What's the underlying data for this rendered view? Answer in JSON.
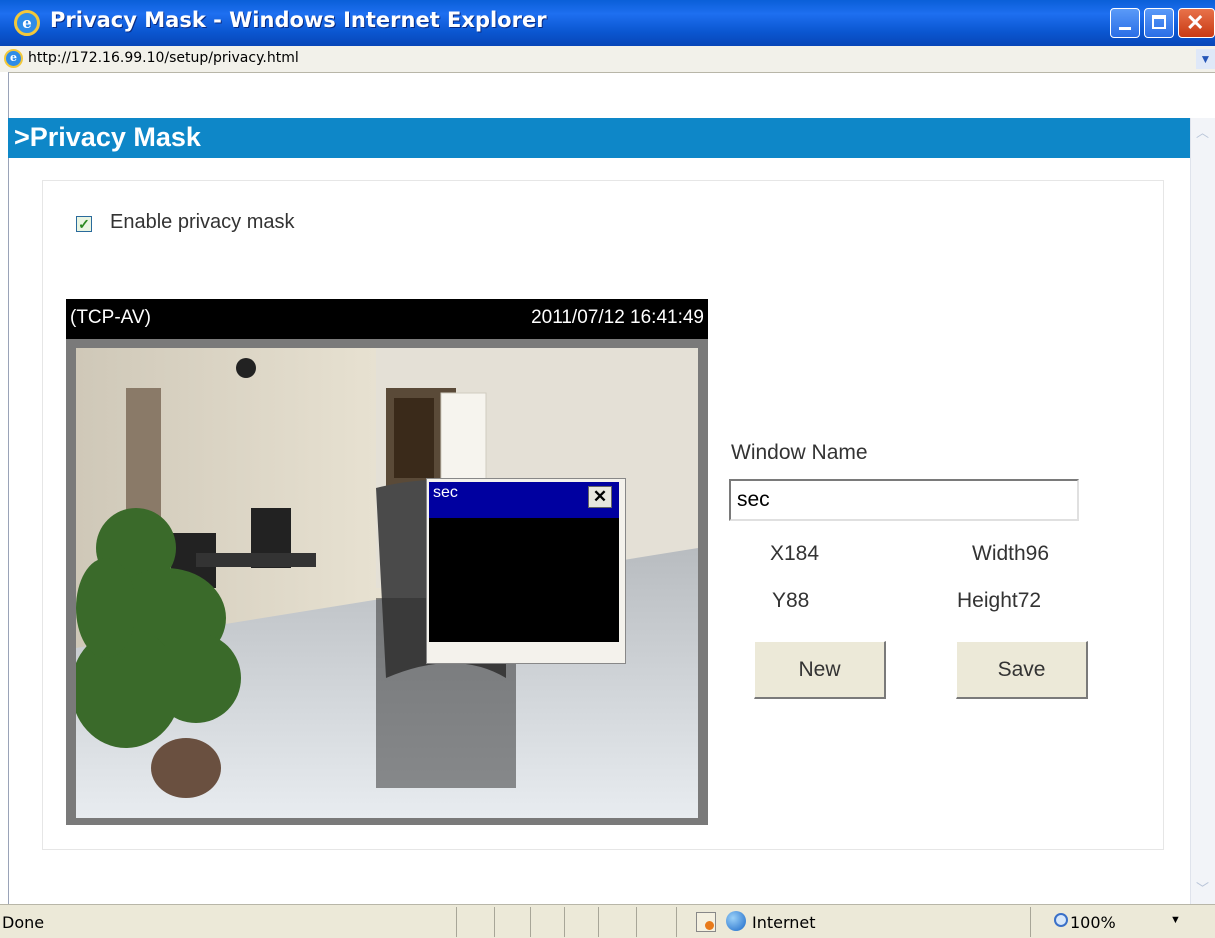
{
  "window": {
    "title": "Privacy Mask - Windows Internet Explorer",
    "url": "http://172.16.99.10/setup/privacy.html"
  },
  "page": {
    "heading": ">Privacy Mask",
    "enable_label": "Enable privacy mask",
    "enable_checked": true
  },
  "video": {
    "protocol": "(TCP-AV)",
    "timestamp": "2011/07/12 16:41:49"
  },
  "mask": {
    "name": "sec",
    "close_glyph": "✕"
  },
  "form": {
    "window_name_label": "Window Name",
    "window_name_value": "sec",
    "x_label": "X184",
    "y_label": "Y88",
    "width_label": "Width96",
    "height_label": "Height72",
    "new_button": "New",
    "save_button": "Save"
  },
  "status": {
    "text": "Done",
    "zone": "Internet",
    "zoom": "100%"
  },
  "colors": {
    "header": "#0e87c8",
    "titlebar": "#0a5fd8",
    "mask_bar": "#0000a0"
  },
  "icons": [
    "ie-logo-icon",
    "minimize-icon",
    "maximize-icon",
    "close-icon",
    "page-icon",
    "dropdown-icon",
    "scroll-up-icon",
    "scroll-down-icon",
    "lock-icon",
    "globe-icon",
    "zoom-icon"
  ]
}
